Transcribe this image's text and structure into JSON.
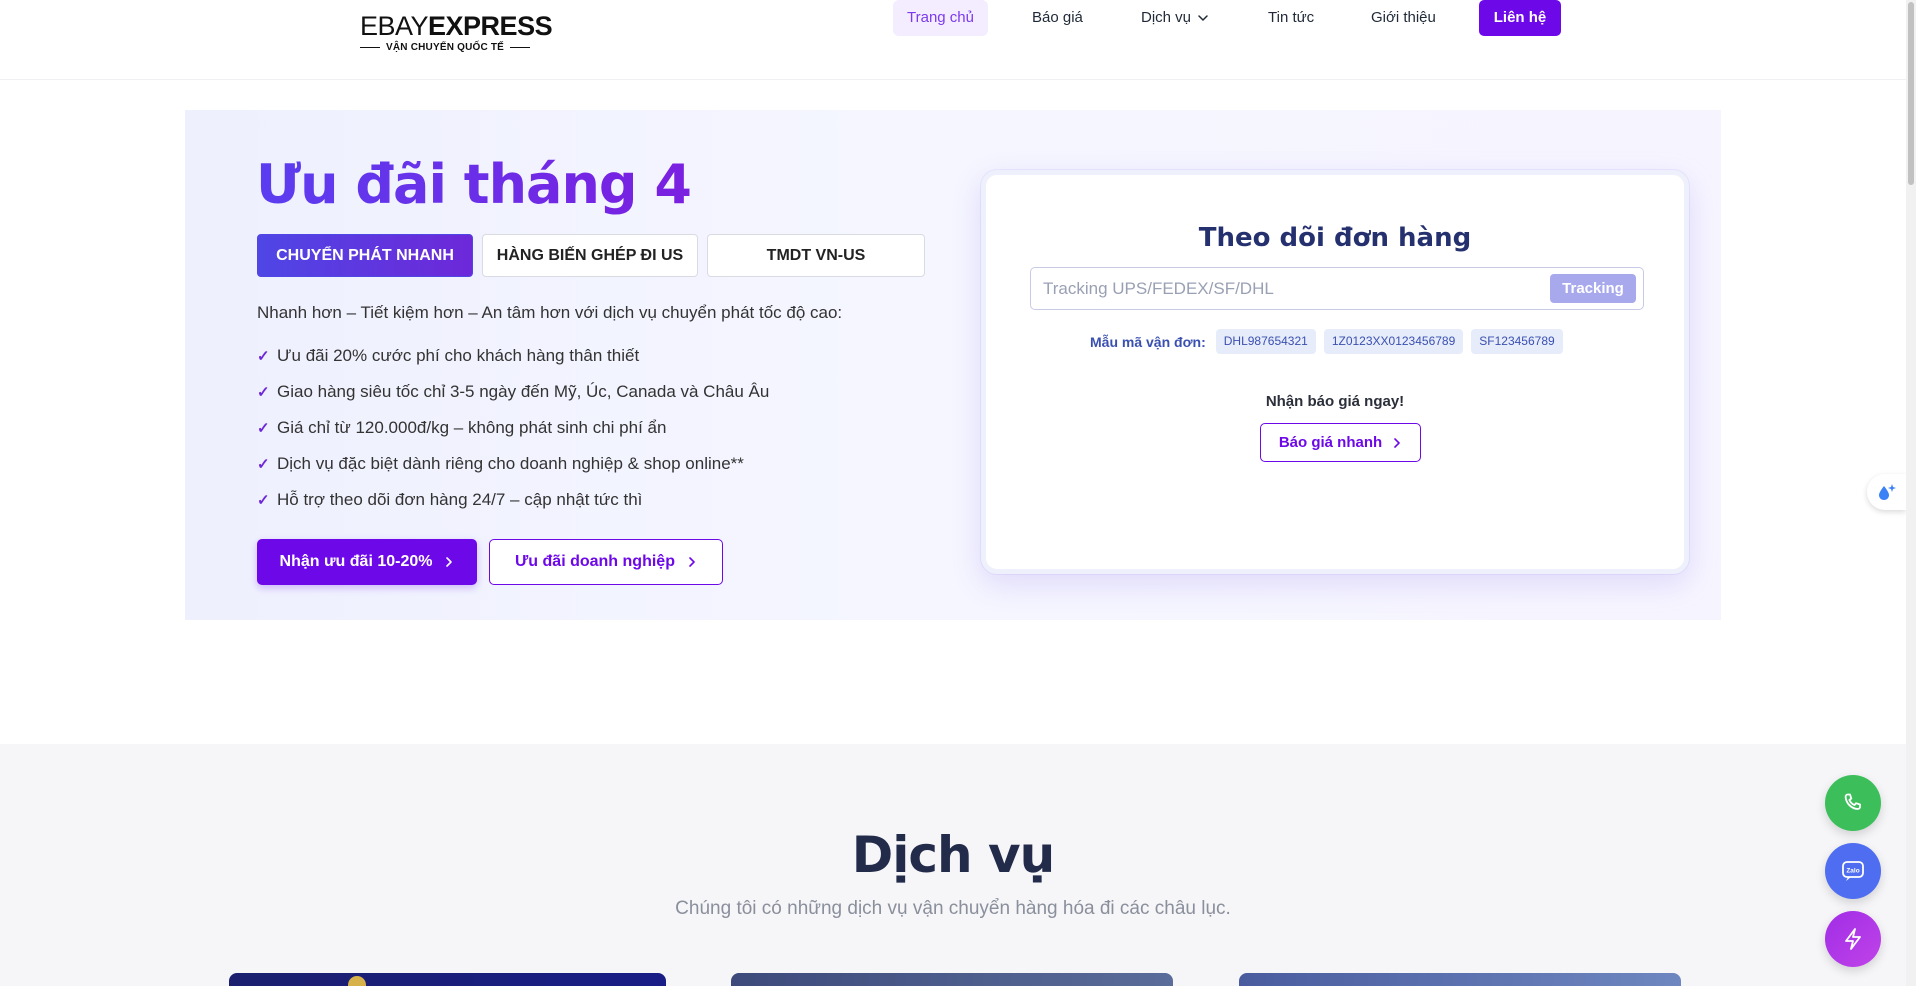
{
  "brand": {
    "logo_light": "EBAY",
    "logo_bold": "EXPRESS",
    "tagline": "VẬN CHUYỂN QUỐC TẾ"
  },
  "nav": {
    "home": "Trang chủ",
    "quote": "Báo giá",
    "services": "Dịch vụ",
    "news": "Tin tức",
    "about": "Giới thiệu",
    "contact": "Liên hệ"
  },
  "hero": {
    "title": "Ưu đãi tháng 4",
    "tabs": [
      {
        "label": "CHUYỂN PHÁT NHANH",
        "active": true
      },
      {
        "label": "HÀNG BIẾN GHÉP ĐI US",
        "active": false
      },
      {
        "label": "TMDT VN-US",
        "active": false
      }
    ],
    "intro": "Nhanh hơn – Tiết kiệm hơn – An tâm hơn với dịch vụ chuyển phát tốc độ cao:",
    "benefits": [
      "Ưu đãi 20% cước phí cho khách hàng thân thiết",
      "Giao hàng siêu tốc chỉ 3-5 ngày đến Mỹ, Úc, Canada và Châu Âu",
      "Giá chỉ từ 120.000đ/kg – không phát sinh chi phí ẩn",
      "Dịch vụ đặc biệt dành riêng cho doanh nghiệp & shop online**",
      "Hỗ trợ theo dõi đơn hàng 24/7 – cập nhật tức thì"
    ],
    "cta_primary": "Nhận ưu đãi 10-20%",
    "cta_secondary": "Ưu đãi doanh nghiệp"
  },
  "tracking": {
    "title": "Theo dõi đơn hàng",
    "input_value": "",
    "input_placeholder": "Tracking UPS/FEDEX/SF/DHL",
    "button": "Tracking",
    "samples_label": "Mẫu mã vận đơn:",
    "samples": [
      "DHL987654321",
      "1Z0123XX0123456789",
      "SF123456789"
    ],
    "quote_label": "Nhận báo giá ngay!",
    "quote_button": "Báo giá nhanh"
  },
  "services": {
    "title": "Dịch vụ",
    "subtitle": "Chúng tôi có những dịch vụ vận chuyển hàng hóa đi các châu lục."
  },
  "colors": {
    "primary": "#6d08e8",
    "title_gradient_start": "#5b3df0",
    "title_gradient_end": "#7b1fe0",
    "navy": "#25306f",
    "phone_green": "#3cbf5a",
    "zalo_blue": "#4f6df0"
  },
  "icons": {
    "nav_dropdown": "chevron-down-icon",
    "check": "check-icon",
    "cta_arrow": "chevron-right-icon",
    "side_widget": "sparkle-drop-icon",
    "fab_phone": "phone-icon",
    "fab_zalo": "zalo-chat-icon",
    "fab_bolt": "lightning-icon"
  }
}
